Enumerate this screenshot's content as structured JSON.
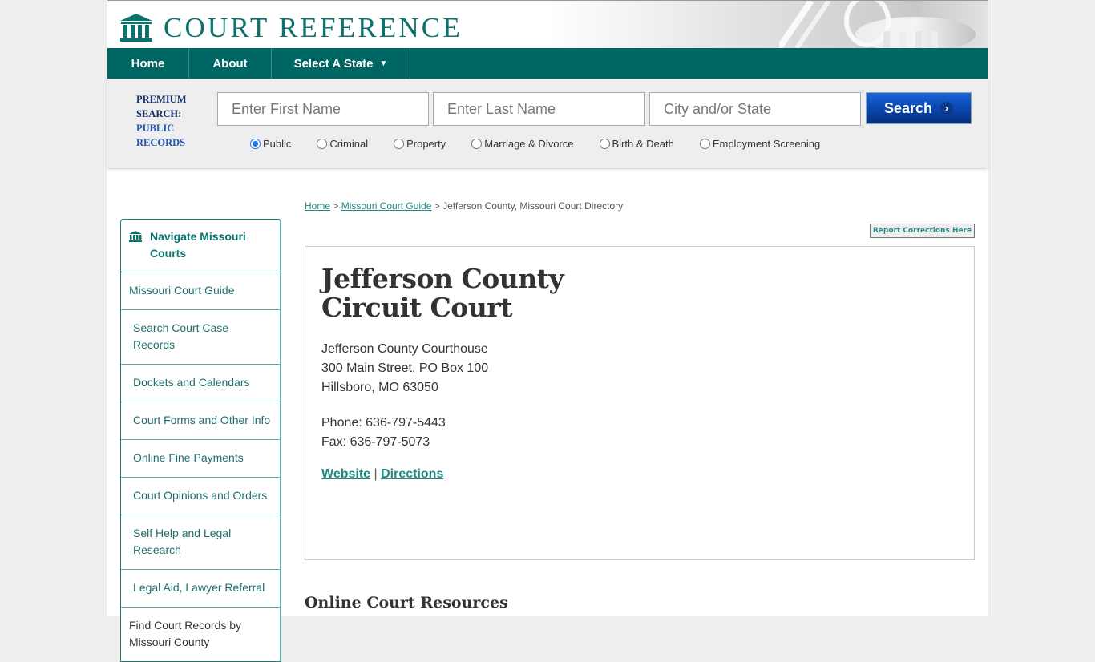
{
  "brand": {
    "name": "COURT REFERENCE",
    "color": "#0b736d",
    "nav_color": "#006663"
  },
  "nav": {
    "items": [
      {
        "label": "Home"
      },
      {
        "label": "About"
      },
      {
        "label": "Select A State",
        "icon": "caret-down-icon"
      }
    ],
    "caret": "▼"
  },
  "search": {
    "premium_line1": "PREMIUM",
    "premium_line2": "SEARCH:",
    "premium_line3": "PUBLIC",
    "premium_line4": "RECORDS",
    "first_name_placeholder": "Enter First Name",
    "last_name_placeholder": "Enter Last Name",
    "city_placeholder": "City and/or State",
    "button_label": "Search",
    "button_arrow": "›",
    "record_types": [
      {
        "label": "Public",
        "selected": true
      },
      {
        "label": "Criminal",
        "selected": false
      },
      {
        "label": "Property",
        "selected": false
      },
      {
        "label": "Marriage & Divorce",
        "selected": false
      },
      {
        "label": "Birth & Death",
        "selected": false
      },
      {
        "label": "Employment Screening",
        "selected": false
      }
    ]
  },
  "breadcrumb": {
    "home": "Home",
    "sep": " > ",
    "guide": "Missouri Court Guide",
    "current": "Jefferson County, Missouri Court Directory"
  },
  "report_button": "Report Corrections Here",
  "sidebar": {
    "title_line1": "Navigate Missouri",
    "title_line2": "Courts",
    "items": [
      {
        "label": "Missouri Court Guide"
      },
      {
        "label": "Search Court Case Records"
      },
      {
        "label": "Dockets and Calendars"
      },
      {
        "label": "Court Forms and Other Info"
      },
      {
        "label": "Online Fine Payments"
      },
      {
        "label": "Court Opinions and Orders"
      },
      {
        "label": "Self Help and Legal Research"
      },
      {
        "label": "Legal Aid, Lawyer Referral"
      },
      {
        "label": "Find Court Records by Missouri County"
      }
    ]
  },
  "court": {
    "title_line1": "Jefferson County",
    "title_line2": "Circuit Court",
    "address_line1": "Jefferson County Courthouse",
    "address_line2": "300 Main Street, PO Box 100",
    "address_line3": "Hillsboro, MO 63050",
    "phone": "Phone: 636-797-5443",
    "fax": "Fax: 636-797-5073",
    "website_label": "Website",
    "link_sep": " | ",
    "directions_label": "Directions"
  },
  "resources_heading": "Online Court Resources"
}
